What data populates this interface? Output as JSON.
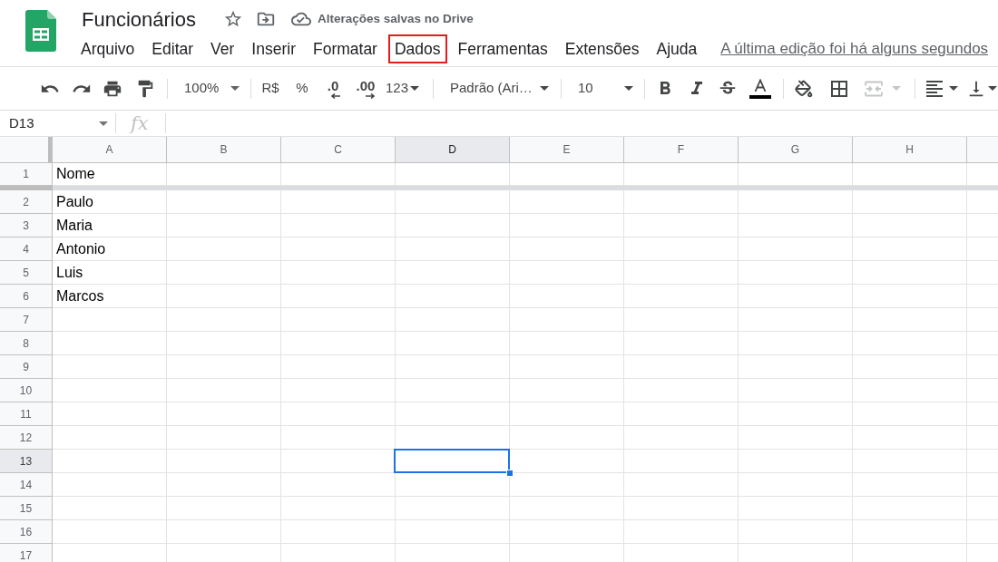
{
  "document": {
    "title": "Funcionários",
    "save_status": "Alterações salvas no Drive"
  },
  "menu": [
    {
      "label": "Arquivo",
      "highlighted": false
    },
    {
      "label": "Editar",
      "highlighted": false
    },
    {
      "label": "Ver",
      "highlighted": false
    },
    {
      "label": "Inserir",
      "highlighted": false
    },
    {
      "label": "Formatar",
      "highlighted": false
    },
    {
      "label": "Dados",
      "highlighted": true
    },
    {
      "label": "Ferramentas",
      "highlighted": false
    },
    {
      "label": "Extensões",
      "highlighted": false
    },
    {
      "label": "Ajuda",
      "highlighted": false
    }
  ],
  "last_edit": "A última edição foi há alguns segundos",
  "toolbar": {
    "zoom": "100%",
    "currency": "R$",
    "percent": "%",
    "decrease_decimal": ".0",
    "increase_decimal": ".00",
    "number_format": "123",
    "font": "Padrão (Ari…",
    "font_size": "10",
    "merge_cells": {
      "disabled": true
    }
  },
  "formula_bar": {
    "name_box": "D13",
    "fx_label": "fx"
  },
  "sheet": {
    "columns": [
      {
        "label": "A",
        "selected": false
      },
      {
        "label": "B",
        "selected": false
      },
      {
        "label": "C",
        "selected": false
      },
      {
        "label": "D",
        "selected": true
      },
      {
        "label": "E",
        "selected": false
      },
      {
        "label": "F",
        "selected": false
      },
      {
        "label": "G",
        "selected": false
      },
      {
        "label": "H",
        "selected": false
      }
    ],
    "rows": [
      {
        "label": "1",
        "selected": false,
        "frozen": true,
        "cells": [
          "Nome"
        ]
      },
      {
        "label": "2",
        "selected": false,
        "cells": [
          "Paulo"
        ]
      },
      {
        "label": "3",
        "selected": false,
        "cells": [
          "Maria"
        ]
      },
      {
        "label": "4",
        "selected": false,
        "cells": [
          "Antonio"
        ]
      },
      {
        "label": "5",
        "selected": false,
        "cells": [
          "Luis"
        ]
      },
      {
        "label": "6",
        "selected": false,
        "cells": [
          "Marcos"
        ]
      },
      {
        "label": "7",
        "selected": false
      },
      {
        "label": "8",
        "selected": false
      },
      {
        "label": "9",
        "selected": false
      },
      {
        "label": "10",
        "selected": false
      },
      {
        "label": "11",
        "selected": false
      },
      {
        "label": "12",
        "selected": false
      },
      {
        "label": "13",
        "selected": true
      },
      {
        "label": "14",
        "selected": false
      },
      {
        "label": "15",
        "selected": false
      },
      {
        "label": "16",
        "selected": false
      },
      {
        "label": "17",
        "selected": false
      }
    ]
  }
}
